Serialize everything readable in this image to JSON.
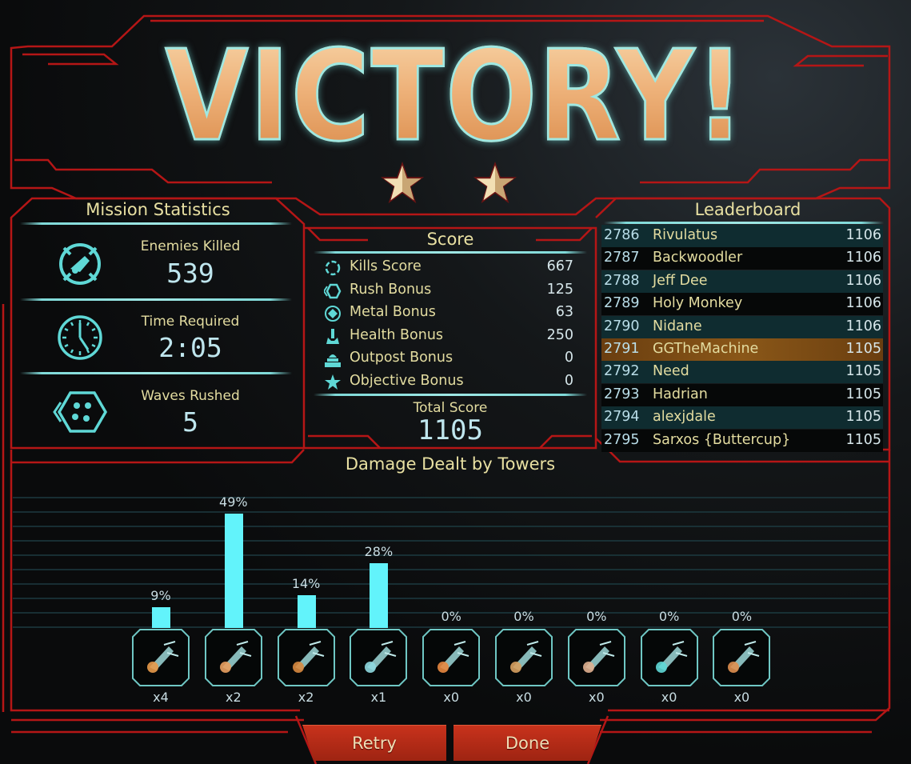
{
  "header": {
    "title": "VICTORY!",
    "stars_earned": 2
  },
  "mission_statistics": {
    "title": "Mission Statistics",
    "items": [
      {
        "icon": "enemy-target-icon",
        "label": "Enemies Killed",
        "value": "539"
      },
      {
        "icon": "clock-icon",
        "label": "Time Required",
        "value": "2:05"
      },
      {
        "icon": "rush-waves-icon",
        "label": "Waves Rushed",
        "value": "5"
      }
    ]
  },
  "score": {
    "title": "Score",
    "rows": [
      {
        "icon": "kills-icon",
        "label": "Kills Score",
        "value": "667"
      },
      {
        "icon": "rush-icon",
        "label": "Rush Bonus",
        "value": "125"
      },
      {
        "icon": "metal-icon",
        "label": "Metal Bonus",
        "value": "63"
      },
      {
        "icon": "health-icon",
        "label": "Health Bonus",
        "value": "250"
      },
      {
        "icon": "outpost-icon",
        "label": "Outpost Bonus",
        "value": "0"
      },
      {
        "icon": "objective-star-icon",
        "label": "Objective Bonus",
        "value": "0"
      }
    ],
    "total_label": "Total Score",
    "total_value": "1105"
  },
  "leaderboard": {
    "title": "Leaderboard",
    "highlight_rank": "2791",
    "rows": [
      {
        "rank": "2786",
        "name": "Rivulatus",
        "score": "1106"
      },
      {
        "rank": "2787",
        "name": "Backwoodler",
        "score": "1106"
      },
      {
        "rank": "2788",
        "name": "Jeff Dee",
        "score": "1106"
      },
      {
        "rank": "2789",
        "name": "Holy Monkey",
        "score": "1106"
      },
      {
        "rank": "2790",
        "name": "Nidane",
        "score": "1106"
      },
      {
        "rank": "2791",
        "name": "GGTheMachine",
        "score": "1105"
      },
      {
        "rank": "2792",
        "name": "Need",
        "score": "1105"
      },
      {
        "rank": "2793",
        "name": "Hadrian",
        "score": "1105"
      },
      {
        "rank": "2794",
        "name": "alexjdale",
        "score": "1105"
      },
      {
        "rank": "2795",
        "name": "Sarxos {Buttercup}",
        "score": "1105"
      }
    ]
  },
  "chart_data": {
    "type": "bar",
    "title": "Damage Dealt by Towers",
    "xlabel": "",
    "ylabel": "",
    "ylim": [
      0,
      55
    ],
    "grid": true,
    "categories": [
      "tower-1",
      "tower-2",
      "tower-3",
      "tower-4",
      "tower-5",
      "tower-6",
      "tower-7",
      "tower-8",
      "tower-9"
    ],
    "values": [
      9,
      49,
      14,
      28,
      0,
      0,
      0,
      0,
      0
    ],
    "value_labels": [
      "9%",
      "49%",
      "14%",
      "28%",
      "0%",
      "0%",
      "0%",
      "0%",
      "0%"
    ],
    "tower_counts": [
      "x4",
      "x2",
      "x2",
      "x1",
      "x0",
      "x0",
      "x0",
      "x0",
      "x0"
    ]
  },
  "buttons": {
    "retry": "Retry",
    "done": "Done"
  },
  "colors": {
    "frame_red": "#c01818",
    "accent_cyan": "#62f3fb",
    "label_gold": "#e3dca0",
    "highlight_row": "#7a4a14"
  }
}
